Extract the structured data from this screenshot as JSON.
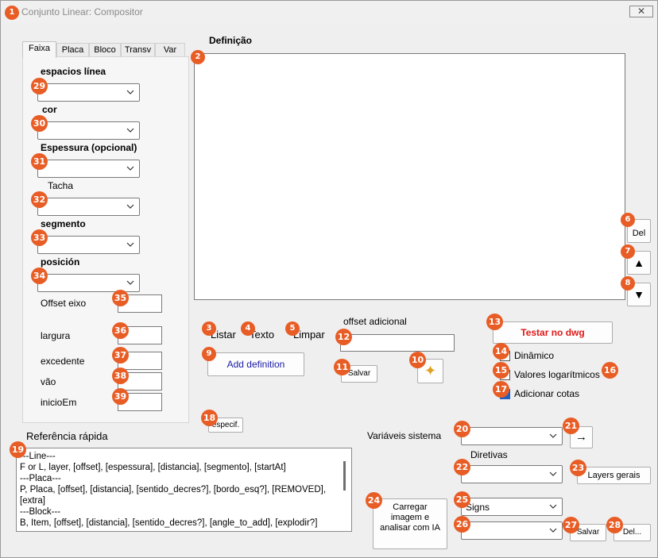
{
  "window": {
    "title": "Conjunto Linear: Compositor",
    "close_symbol": "✕"
  },
  "tabs": [
    "Faixa",
    "Placa",
    "Bloco",
    "Transv",
    "Var"
  ],
  "faixa": {
    "espacios_label": "espacios línea",
    "cor_label": "cor",
    "espessura_label": "Espessura (opcional)",
    "tacha_label": "Tacha",
    "segmento_label": "segmento",
    "posicion_label": "posición",
    "offset_eixo_label": "Offset eixo",
    "largura_label": "largura",
    "excedente_label": "excedente",
    "vao_label": "vão",
    "inicio_label": "inicioEm"
  },
  "definition": {
    "heading": "Definição",
    "del_label": "Del",
    "up_symbol": "▲",
    "down_symbol": "▼"
  },
  "actions": {
    "listar": "Listar",
    "texto": "Texto",
    "limpar": "Limpar",
    "add_definition": "Add definition",
    "especif": "especif."
  },
  "offset": {
    "label": "offset adicional",
    "salvar": "Salvar",
    "sparkle": "✦"
  },
  "testar": {
    "label": "Testar no dwg",
    "color": "#e01818",
    "dinamico": "Dinâmico",
    "valores_log": "Valores logarítmicos",
    "adicionar_cotas": "Adicionar cotas"
  },
  "reference": {
    "heading": "Referência rápida",
    "lines": [
      "---Line---",
      "F or L, layer, [offset], [espessura], [distancia], [segmento], [startAt]",
      "---Placa---",
      "P, Placa, [offset], [distancia], [sentido_decres?], [bordo_esq?], [REMOVED],",
      "[extra]",
      "---Block---",
      "B, Item, [offset], [distancia], [sentido_decres?], [angle_to_add], [explodir?]"
    ]
  },
  "system": {
    "variaveis_label": "Variáveis sistema",
    "arrow_symbol": "→",
    "diretivas_label": "Diretivas",
    "layers_gerais": "Layers gerais",
    "carregar_label": "Carregar imagem e analisar com IA",
    "signs_value": "Signs",
    "salvar": "Salvar",
    "del": "Del..."
  },
  "colors": {
    "badge": "#e85d25",
    "add_definition_text": "#1a1aa8",
    "cotas_check": "#1f5fbf"
  },
  "badges": [
    "1",
    "2",
    "3",
    "4",
    "5",
    "6",
    "7",
    "8",
    "9",
    "10",
    "11",
    "12",
    "13",
    "14",
    "15",
    "16",
    "17",
    "18",
    "19",
    "20",
    "21",
    "22",
    "23",
    "24",
    "25",
    "26",
    "27",
    "28",
    "29",
    "30",
    "31",
    "32",
    "33",
    "34",
    "35",
    "36",
    "37",
    "38",
    "39"
  ]
}
